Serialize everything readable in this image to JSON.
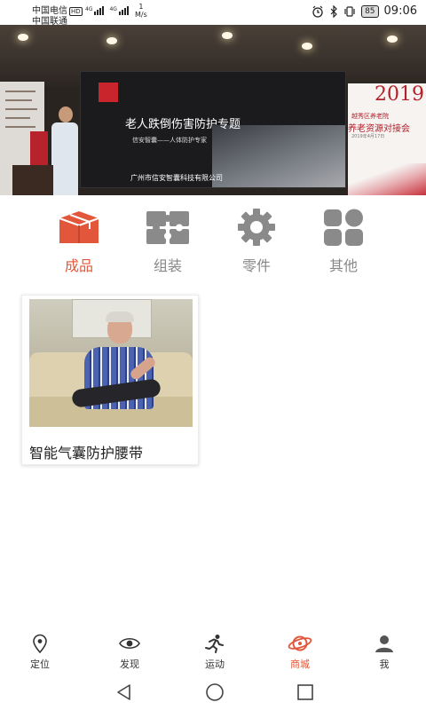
{
  "status_bar": {
    "carrier_1": "中国电信",
    "carrier_1_badge": "HD",
    "carrier_2": "中国联通",
    "net_1": "4G",
    "net_2": "4G",
    "speed_value": "1",
    "speed_unit": "M/s",
    "battery": "85",
    "time": "09:06"
  },
  "banner": {
    "title": "老人跌倒伤害防护专题",
    "subtitle": "信安智囊——人体防护专家",
    "company": "广州市信安智囊科技有限公司",
    "right_year": "2019",
    "right_line1": "越秀区养老院",
    "right_line2": "养老资源对接会",
    "right_line3": "2019年4月17日"
  },
  "categories": [
    {
      "label": "成品",
      "icon": "box-icon",
      "active": true
    },
    {
      "label": "组装",
      "icon": "puzzle-icon",
      "active": false
    },
    {
      "label": "零件",
      "icon": "gear-icon",
      "active": false
    },
    {
      "label": "其他",
      "icon": "grid-icon",
      "active": false
    }
  ],
  "products": [
    {
      "name": "智能气囊防护腰带"
    }
  ],
  "bottom_nav": [
    {
      "label": "定位",
      "icon": "location-pin-icon",
      "active": false
    },
    {
      "label": "发现",
      "icon": "eye-icon",
      "active": false
    },
    {
      "label": "运动",
      "icon": "running-icon",
      "active": false
    },
    {
      "label": "商城",
      "icon": "planet-icon",
      "active": true
    },
    {
      "label": "我",
      "icon": "person-icon",
      "active": false
    }
  ],
  "colors": {
    "accent": "#e2573b",
    "icon_inactive": "#8a8a8a",
    "text_inactive": "#888888"
  }
}
